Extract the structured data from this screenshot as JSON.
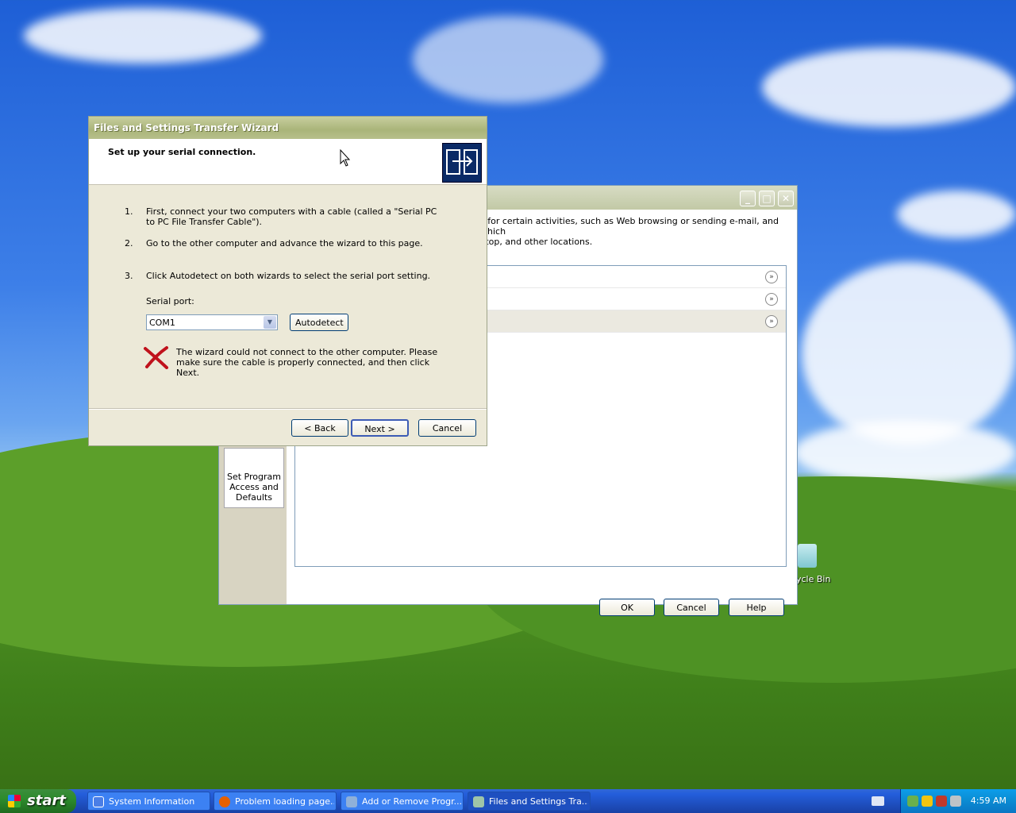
{
  "wizard": {
    "title": "Files and Settings Transfer Wizard",
    "header": "Set up your serial connection.",
    "steps": [
      {
        "num": "1.",
        "text": "First, connect your two computers with a cable (called a \"Serial PC to PC File Transfer Cable\")."
      },
      {
        "num": "2.",
        "text": "Go to the other computer and advance the wizard to this page."
      },
      {
        "num": "3.",
        "text": "Click Autodetect on both wizards to select the serial port setting."
      }
    ],
    "serial_port_label": "Serial port:",
    "serial_port_value": "COM1",
    "autodetect_label": "Autodetect",
    "error_message": "The wizard could not connect to the other computer. Please make sure the cable is properly connected, and then click Next.",
    "back_label": "< Back",
    "next_label": "Next >",
    "cancel_label": "Cancel"
  },
  "back_window": {
    "description_line1": "s for certain activities, such as Web browsing or sending e-mail, and which",
    "description_line2": "ktop, and other locations.",
    "sidebar_item": "Set Program Access and Defaults",
    "ok_label": "OK",
    "cancel_label": "Cancel",
    "help_label": "Help"
  },
  "desktop": {
    "recycle_bin_label": "ycle Bin"
  },
  "taskbar": {
    "start_label": "start",
    "tasks": [
      {
        "label": "System Information",
        "icon": "help-icon"
      },
      {
        "label": "Problem loading page...",
        "icon": "firefox-icon"
      },
      {
        "label": "Add or Remove Progr...",
        "icon": "add-remove-programs-icon"
      },
      {
        "label": "Files and Settings Tra...",
        "icon": "transfer-wizard-icon"
      }
    ],
    "clock": "4:59 AM"
  }
}
